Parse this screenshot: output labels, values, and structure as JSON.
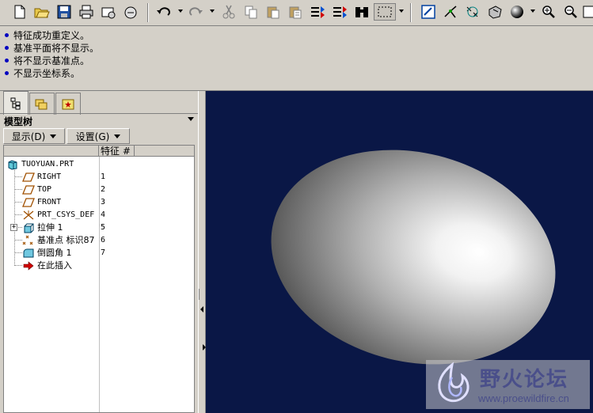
{
  "toolbar": {
    "buttons": [
      "new-file",
      "open-file",
      "save",
      "print",
      "send-mail",
      "lock",
      "undo",
      "redo",
      "cut",
      "copy",
      "paste",
      "paste-special",
      "regenerate",
      "regen-manager",
      "find",
      "select-box",
      "saved-views",
      "datum-axis",
      "datum-point",
      "csys",
      "shading",
      "zoom-in",
      "zoom-out"
    ]
  },
  "messages": [
    "特征成功重定义。",
    "基准平面将不显示。",
    "将不显示基准点。",
    "不显示坐标系。"
  ],
  "panel": {
    "title": "模型树",
    "show_button": "显示(D)",
    "settings_button": "设置(G)",
    "column_feature": "特征 #"
  },
  "tree": {
    "root": "TUOYUAN.PRT",
    "items": [
      {
        "label": "RIGHT",
        "num": "1",
        "icon": "datum-plane-icon"
      },
      {
        "label": "TOP",
        "num": "2",
        "icon": "datum-plane-icon"
      },
      {
        "label": "FRONT",
        "num": "3",
        "icon": "datum-plane-icon"
      },
      {
        "label": "PRT_CSYS_DEF",
        "num": "4",
        "icon": "csys-icon"
      },
      {
        "label": "拉伸 1",
        "num": "5",
        "icon": "extrude-icon"
      },
      {
        "label": "基准点 标识87",
        "num": "6",
        "icon": "datum-point-icon"
      },
      {
        "label": "倒圆角 1",
        "num": "7",
        "icon": "round-icon"
      },
      {
        "label": "在此插入",
        "num": "",
        "icon": "insert-here-icon"
      }
    ]
  },
  "watermark": {
    "title": "野火论坛",
    "url": "www.proewildfire.cn"
  },
  "colors": {
    "viewport_bg": "#0a1746",
    "window_bg": "#d4d0c8",
    "message_dot": "#0000c0"
  }
}
